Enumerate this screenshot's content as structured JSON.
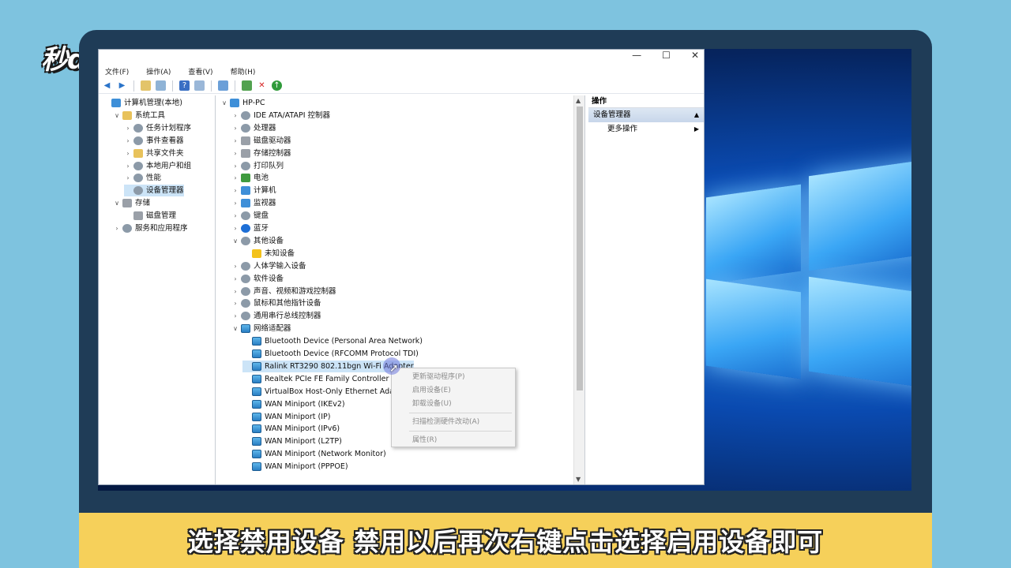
{
  "watermark": {
    "logo_text": "秒dong视频"
  },
  "window": {
    "controls": {
      "minimize": "—",
      "maximize": "☐",
      "close": "✕"
    },
    "menu": [
      "文件(F)",
      "操作(A)",
      "查看(V)",
      "帮助(H)"
    ]
  },
  "toolbar": {
    "icons": [
      "back-arrow-icon",
      "forward-arrow-icon",
      "up-folder-icon",
      "show-hide-tree-icon",
      "help-icon",
      "view-icon",
      "monitor-icon",
      "update-driver-icon",
      "uninstall-icon",
      "enable-icon"
    ]
  },
  "left_tree": [
    {
      "label": "计算机管理(本地)",
      "indent": 0,
      "expander": "",
      "icon": "computer-management-icon"
    },
    {
      "label": "系统工具",
      "indent": 1,
      "expander": "∨",
      "icon": "system-tools-icon"
    },
    {
      "label": "任务计划程序",
      "indent": 2,
      "expander": "›",
      "icon": "task-scheduler-icon"
    },
    {
      "label": "事件查看器",
      "indent": 2,
      "expander": "›",
      "icon": "event-viewer-icon"
    },
    {
      "label": "共享文件夹",
      "indent": 2,
      "expander": "›",
      "icon": "shared-folder-icon"
    },
    {
      "label": "本地用户和组",
      "indent": 2,
      "expander": "›",
      "icon": "local-users-icon"
    },
    {
      "label": "性能",
      "indent": 2,
      "expander": "›",
      "icon": "performance-icon"
    },
    {
      "label": "设备管理器",
      "indent": 2,
      "expander": "",
      "icon": "device-manager-icon",
      "selected": true
    },
    {
      "label": "存储",
      "indent": 1,
      "expander": "∨",
      "icon": "storage-icon"
    },
    {
      "label": "磁盘管理",
      "indent": 2,
      "expander": "",
      "icon": "disk-management-icon"
    },
    {
      "label": "服务和应用程序",
      "indent": 1,
      "expander": "›",
      "icon": "services-apps-icon"
    }
  ],
  "device_tree": [
    {
      "label": "HP-PC",
      "indent": 0,
      "expander": "∨",
      "icon": "computer-icon"
    },
    {
      "label": "IDE ATA/ATAPI 控制器",
      "indent": 1,
      "expander": "›",
      "icon": "ide-controller-icon"
    },
    {
      "label": "处理器",
      "indent": 1,
      "expander": "›",
      "icon": "processor-icon"
    },
    {
      "label": "磁盘驱动器",
      "indent": 1,
      "expander": "›",
      "icon": "disk-drive-icon"
    },
    {
      "label": "存储控制器",
      "indent": 1,
      "expander": "›",
      "icon": "storage-controller-icon"
    },
    {
      "label": "打印队列",
      "indent": 1,
      "expander": "›",
      "icon": "printer-icon"
    },
    {
      "label": "电池",
      "indent": 1,
      "expander": "›",
      "icon": "battery-icon"
    },
    {
      "label": "计算机",
      "indent": 1,
      "expander": "›",
      "icon": "computer-icon"
    },
    {
      "label": "监视器",
      "indent": 1,
      "expander": "›",
      "icon": "monitor-icon"
    },
    {
      "label": "键盘",
      "indent": 1,
      "expander": "›",
      "icon": "keyboard-icon"
    },
    {
      "label": "蓝牙",
      "indent": 1,
      "expander": "›",
      "icon": "bluetooth-icon"
    },
    {
      "label": "其他设备",
      "indent": 1,
      "expander": "∨",
      "icon": "other-devices-icon"
    },
    {
      "label": "未知设备",
      "indent": 2,
      "expander": "",
      "icon": "unknown-device-warning-icon"
    },
    {
      "label": "人体学输入设备",
      "indent": 1,
      "expander": "›",
      "icon": "hid-icon"
    },
    {
      "label": "软件设备",
      "indent": 1,
      "expander": "›",
      "icon": "software-device-icon"
    },
    {
      "label": "声音、视频和游戏控制器",
      "indent": 1,
      "expander": "›",
      "icon": "sound-icon"
    },
    {
      "label": "鼠标和其他指针设备",
      "indent": 1,
      "expander": "›",
      "icon": "mouse-icon"
    },
    {
      "label": "通用串行总线控制器",
      "indent": 1,
      "expander": "›",
      "icon": "usb-icon"
    },
    {
      "label": "网络适配器",
      "indent": 1,
      "expander": "∨",
      "icon": "network-adapter-icon"
    },
    {
      "label": "Bluetooth Device (Personal Area Network)",
      "indent": 2,
      "expander": "",
      "icon": "network-adapter-icon"
    },
    {
      "label": "Bluetooth Device (RFCOMM Protocol TDI)",
      "indent": 2,
      "expander": "",
      "icon": "network-adapter-icon"
    },
    {
      "label": "Ralink RT3290 802.11bgn Wi-Fi Adapter",
      "indent": 2,
      "expander": "",
      "icon": "network-adapter-icon",
      "selected": true
    },
    {
      "label": "Realtek PCIe FE Family Controller",
      "indent": 2,
      "expander": "",
      "icon": "network-adapter-icon"
    },
    {
      "label": "VirtualBox Host-Only Ethernet Adapter",
      "indent": 2,
      "expander": "",
      "icon": "network-adapter-icon"
    },
    {
      "label": "WAN Miniport (IKEv2)",
      "indent": 2,
      "expander": "",
      "icon": "network-adapter-icon"
    },
    {
      "label": "WAN Miniport (IP)",
      "indent": 2,
      "expander": "",
      "icon": "network-adapter-icon"
    },
    {
      "label": "WAN Miniport (IPv6)",
      "indent": 2,
      "expander": "",
      "icon": "network-adapter-icon"
    },
    {
      "label": "WAN Miniport (L2TP)",
      "indent": 2,
      "expander": "",
      "icon": "network-adapter-icon"
    },
    {
      "label": "WAN Miniport (Network Monitor)",
      "indent": 2,
      "expander": "",
      "icon": "network-adapter-icon"
    },
    {
      "label": "WAN Miniport (PPPOE)",
      "indent": 2,
      "expander": "",
      "icon": "network-adapter-icon"
    }
  ],
  "context_menu": {
    "items": [
      "更新驱动程序(P)",
      "启用设备(E)",
      "卸载设备(U)",
      "扫描检测硬件改动(A)",
      "属性(R)"
    ]
  },
  "actions_pane": {
    "header": "操作",
    "section": "设备管理器",
    "section_caret": "▲",
    "more": "更多操作",
    "more_caret": "▶"
  },
  "subtitle": {
    "text": "选择禁用设备  禁用以后再次右键点击选择启用设备即可"
  }
}
